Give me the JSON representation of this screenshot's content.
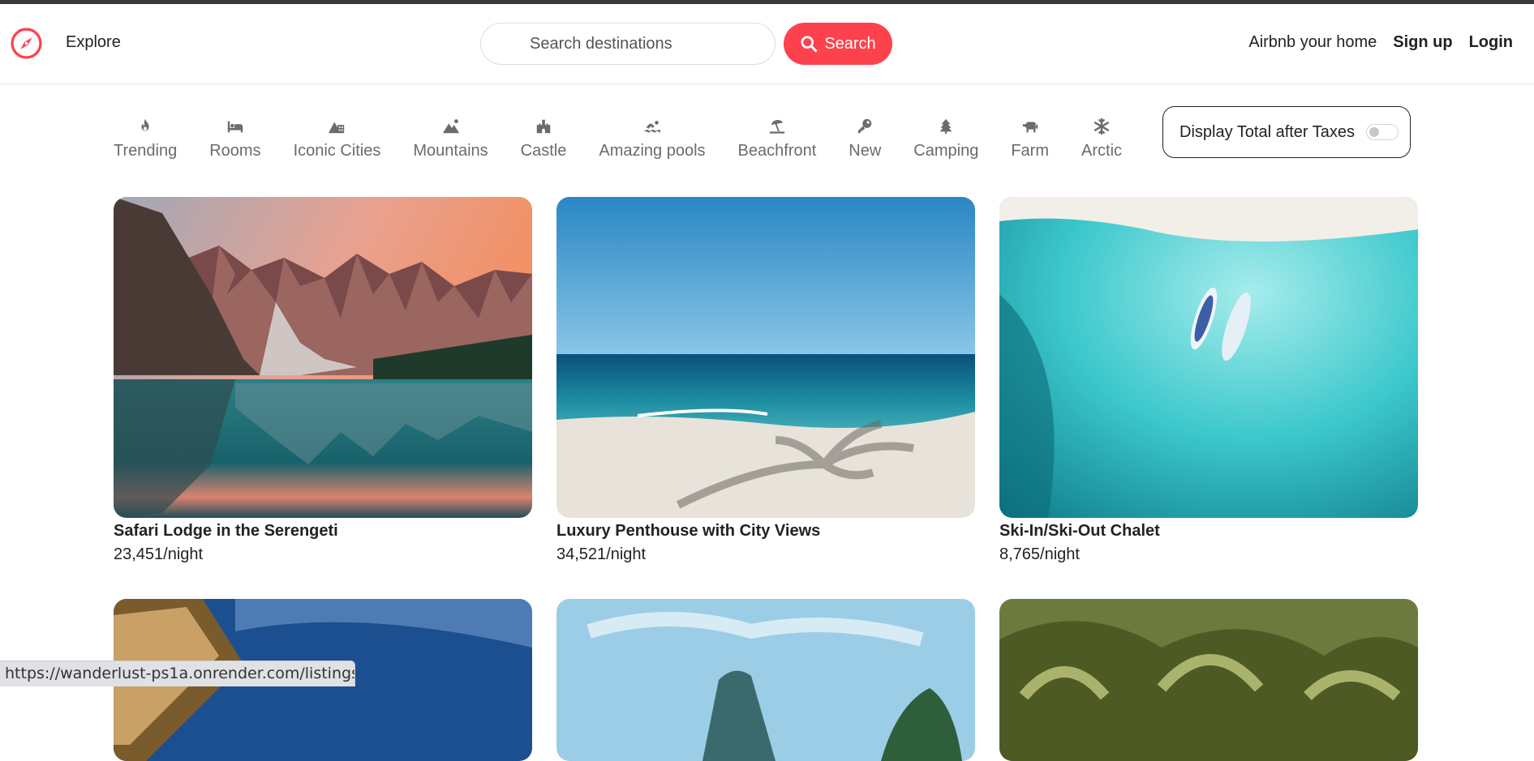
{
  "navbar": {
    "explore_label": "Explore",
    "search_placeholder": "Search destinations",
    "search_button_label": "Search",
    "links": {
      "host": "Airbnb your home",
      "signup": "Sign up",
      "login": "Login"
    },
    "brand_color": "#fe424d"
  },
  "filters": [
    {
      "label": "Trending",
      "icon": "fire-icon"
    },
    {
      "label": "Rooms",
      "icon": "bed-icon"
    },
    {
      "label": "Iconic Cities",
      "icon": "mountain-city-icon"
    },
    {
      "label": "Mountains",
      "icon": "mountain-sun-icon"
    },
    {
      "label": "Castle",
      "icon": "castle-icon"
    },
    {
      "label": "Amazing pools",
      "icon": "person-swimming-icon"
    },
    {
      "label": "Beachfront",
      "icon": "umbrella-beach-icon"
    },
    {
      "label": "New",
      "icon": "key-icon"
    },
    {
      "label": "Camping",
      "icon": "tree-icon"
    },
    {
      "label": "Farm",
      "icon": "cow-icon"
    },
    {
      "label": "Arctic",
      "icon": "snowflake-icon"
    }
  ],
  "tax_toggle": {
    "label": "Display Total after Taxes",
    "checked": false
  },
  "listings": [
    {
      "title": "Safari Lodge in the Serengeti",
      "price": "23,451/night",
      "image": "mountain-lake-reflection"
    },
    {
      "title": "Luxury Penthouse with City Views",
      "price": "34,521/night",
      "image": "tropical-beach-palm-shadow"
    },
    {
      "title": "Ski-In/Ski-Out Chalet",
      "price": "8,765/night",
      "image": "turquoise-water-aerial-boats"
    },
    {
      "title": "",
      "price": "",
      "image": "hotel-balcony-blue-sky"
    },
    {
      "title": "",
      "price": "",
      "image": "tropical-island-cliffs"
    },
    {
      "title": "",
      "price": "",
      "image": "coconut-palm-grove"
    }
  ],
  "status_bar": {
    "url": "https://wanderlust-ps1a.onrender.com/listings"
  }
}
